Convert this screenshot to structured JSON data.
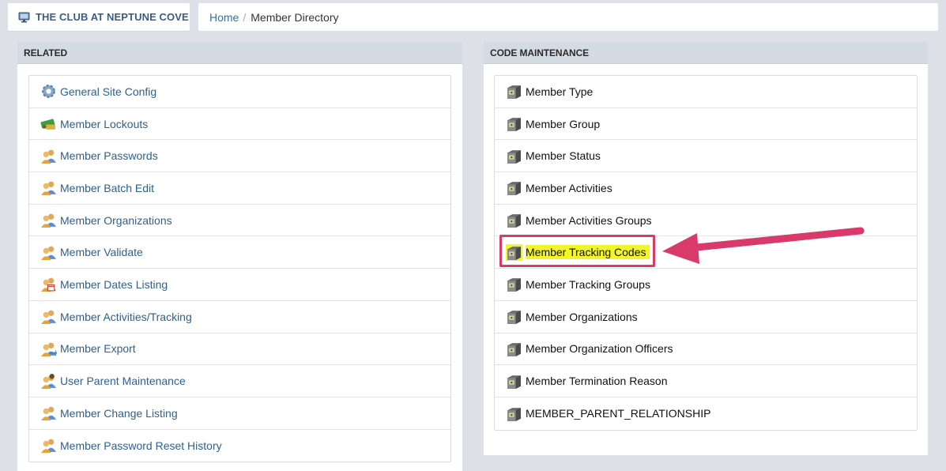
{
  "header": {
    "brand_title": "THE CLUB AT NEPTUNE COVE",
    "brand_icon": "monitor-icon"
  },
  "breadcrumb": {
    "home": "Home",
    "separator": "/",
    "current": "Member Directory"
  },
  "related": {
    "title": "RELATED",
    "items": [
      {
        "label": "General Site Config",
        "icon": "gear-icon"
      },
      {
        "label": "Member Lockouts",
        "icon": "lockout-icon"
      },
      {
        "label": "Member Passwords",
        "icon": "users-icon"
      },
      {
        "label": "Member Batch Edit",
        "icon": "users-icon"
      },
      {
        "label": "Member Organizations",
        "icon": "users-icon"
      },
      {
        "label": "Member Validate",
        "icon": "users-icon"
      },
      {
        "label": "Member Dates Listing",
        "icon": "users-calendar-icon"
      },
      {
        "label": "Member Activities/Tracking",
        "icon": "users-icon"
      },
      {
        "label": "Member Export",
        "icon": "users-export-icon"
      },
      {
        "label": "User Parent Maintenance",
        "icon": "user-parent-icon"
      },
      {
        "label": "Member Change Listing",
        "icon": "users-icon"
      },
      {
        "label": "Member Password Reset History",
        "icon": "users-icon"
      }
    ]
  },
  "code_maintenance": {
    "title": "CODE MAINTENANCE",
    "items": [
      {
        "label": "Member Type",
        "icon": "safe-icon"
      },
      {
        "label": "Member Group",
        "icon": "safe-icon"
      },
      {
        "label": "Member Status",
        "icon": "safe-icon"
      },
      {
        "label": "Member Activities",
        "icon": "safe-icon"
      },
      {
        "label": "Member Activities Groups",
        "icon": "safe-icon"
      },
      {
        "label": "Member Tracking Codes",
        "icon": "safe-icon",
        "highlighted": true
      },
      {
        "label": "Member Tracking Groups",
        "icon": "safe-icon"
      },
      {
        "label": "Member Organizations",
        "icon": "safe-icon"
      },
      {
        "label": "Member Organization Officers",
        "icon": "safe-icon"
      },
      {
        "label": "Member Termination Reason",
        "icon": "safe-icon"
      },
      {
        "label": "MEMBER_PARENT_RELATIONSHIP",
        "icon": "safe-icon"
      }
    ]
  },
  "colors": {
    "highlight": "#f3f52b",
    "annotation": "#d93a6a",
    "link": "#2f5f8f"
  }
}
